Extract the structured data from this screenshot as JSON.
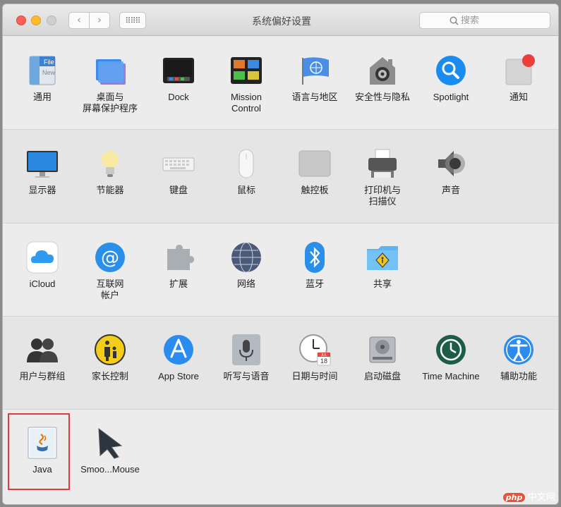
{
  "window": {
    "title": "系统偏好设置"
  },
  "toolbar": {
    "back": "‹",
    "forward": "›",
    "grid": "⠿⠿⠿",
    "search_placeholder": "搜索"
  },
  "sections": [
    {
      "panes": [
        {
          "icon": "general-icon",
          "label": "通用"
        },
        {
          "icon": "desktop-screensaver-icon",
          "label": "桌面与\n屏幕保护程序"
        },
        {
          "icon": "dock-icon",
          "label": "Dock"
        },
        {
          "icon": "mission-control-icon",
          "label": "Mission\nControl"
        },
        {
          "icon": "language-region-icon",
          "label": "语言与地区"
        },
        {
          "icon": "security-privacy-icon",
          "label": "安全性与隐私"
        },
        {
          "icon": "spotlight-icon",
          "label": "Spotlight"
        },
        {
          "icon": "notifications-icon",
          "label": "通知"
        }
      ]
    },
    {
      "panes": [
        {
          "icon": "displays-icon",
          "label": "显示器"
        },
        {
          "icon": "energy-saver-icon",
          "label": "节能器"
        },
        {
          "icon": "keyboard-icon",
          "label": "键盘"
        },
        {
          "icon": "mouse-icon",
          "label": "鼠标"
        },
        {
          "icon": "trackpad-icon",
          "label": "触控板"
        },
        {
          "icon": "printer-scanner-icon",
          "label": "打印机与\n扫描仪"
        },
        {
          "icon": "sound-icon",
          "label": "声音"
        }
      ]
    },
    {
      "panes": [
        {
          "icon": "icloud-icon",
          "label": "iCloud"
        },
        {
          "icon": "internet-accounts-icon",
          "label": "互联网\n帐户"
        },
        {
          "icon": "extensions-icon",
          "label": "扩展"
        },
        {
          "icon": "network-icon",
          "label": "网络"
        },
        {
          "icon": "bluetooth-icon",
          "label": "蓝牙"
        },
        {
          "icon": "sharing-icon",
          "label": "共享"
        }
      ]
    },
    {
      "panes": [
        {
          "icon": "users-groups-icon",
          "label": "用户与群组"
        },
        {
          "icon": "parental-controls-icon",
          "label": "家长控制"
        },
        {
          "icon": "app-store-icon",
          "label": "App Store"
        },
        {
          "icon": "dictation-speech-icon",
          "label": "听写与语音"
        },
        {
          "icon": "date-time-icon",
          "label": "日期与时间"
        },
        {
          "icon": "startup-disk-icon",
          "label": "启动磁盘"
        },
        {
          "icon": "time-machine-icon",
          "label": "Time Machine"
        },
        {
          "icon": "accessibility-icon",
          "label": "辅助功能"
        }
      ]
    },
    {
      "panes": [
        {
          "icon": "java-icon",
          "label": "Java"
        },
        {
          "icon": "smoothmouse-icon",
          "label": "Smoo...Mouse"
        }
      ]
    }
  ],
  "icon_text": {
    "general_file": "File",
    "general_new": "New",
    "calendar_month": "JUL",
    "calendar_day": "18"
  },
  "watermark": {
    "brand": "php",
    "site": "中文网"
  },
  "colors": {
    "highlight": "#e03a3a",
    "accent": "#1a8cf0"
  }
}
